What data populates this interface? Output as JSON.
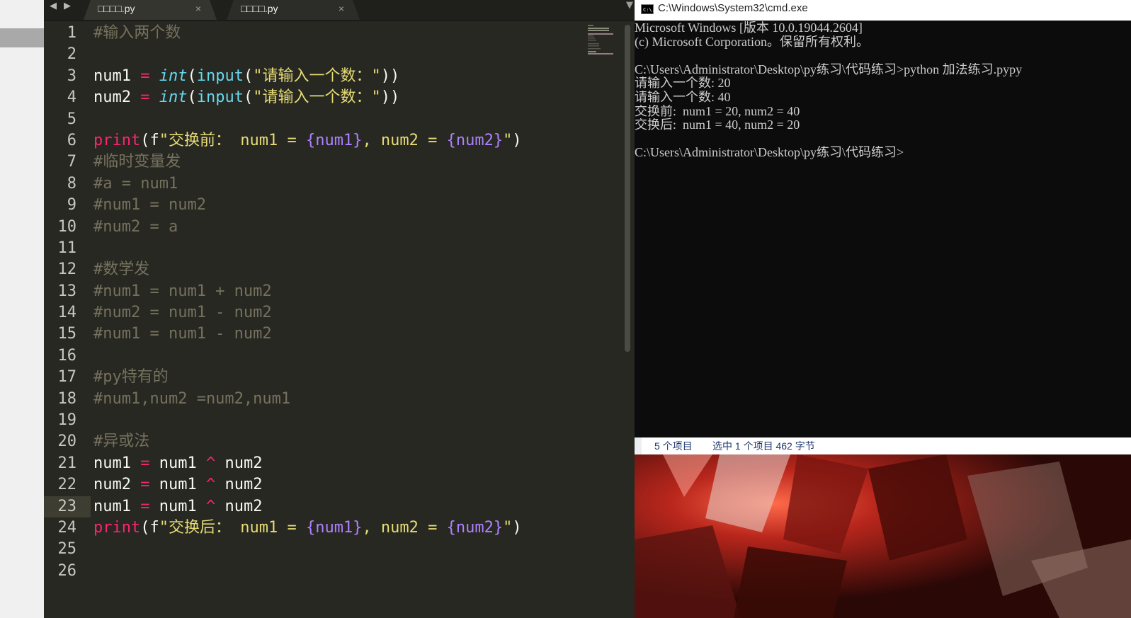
{
  "editor": {
    "tabs": [
      {
        "label": "□□□□.py",
        "close": "×"
      },
      {
        "label": "□□□□.py",
        "close": "×"
      }
    ],
    "nav_left": "◀",
    "nav_right": "▶",
    "dropdown": "▼",
    "lines": [
      {
        "n": "1",
        "segs": [
          {
            "t": "#输入两个数",
            "c": "c"
          }
        ]
      },
      {
        "n": "2",
        "segs": []
      },
      {
        "n": "3",
        "segs": [
          {
            "t": "num1",
            "c": "v"
          },
          {
            "t": " = ",
            "c": "k"
          },
          {
            "t": "int",
            "c": "t"
          },
          {
            "t": "(",
            "c": "v"
          },
          {
            "t": "input",
            "c": "f"
          },
          {
            "t": "(",
            "c": "v"
          },
          {
            "t": "\"请输入一个数：\"",
            "c": "s"
          },
          {
            "t": "))",
            "c": "v"
          }
        ]
      },
      {
        "n": "4",
        "segs": [
          {
            "t": "num2",
            "c": "v"
          },
          {
            "t": " = ",
            "c": "k"
          },
          {
            "t": "int",
            "c": "t"
          },
          {
            "t": "(",
            "c": "v"
          },
          {
            "t": "input",
            "c": "f"
          },
          {
            "t": "(",
            "c": "v"
          },
          {
            "t": "\"请输入一个数：\"",
            "c": "s"
          },
          {
            "t": "))",
            "c": "v"
          }
        ]
      },
      {
        "n": "5",
        "segs": []
      },
      {
        "n": "6",
        "segs": [
          {
            "t": "print",
            "c": "k"
          },
          {
            "t": "(f",
            "c": "v"
          },
          {
            "t": "\"交换前： num1 = ",
            "c": "s"
          },
          {
            "t": "{num1}",
            "c": "p"
          },
          {
            "t": ", num2 = ",
            "c": "s"
          },
          {
            "t": "{num2}",
            "c": "p"
          },
          {
            "t": "\"",
            "c": "s"
          },
          {
            "t": ")",
            "c": "v"
          }
        ]
      },
      {
        "n": "7",
        "segs": [
          {
            "t": "#临时变量发",
            "c": "c"
          }
        ]
      },
      {
        "n": "8",
        "segs": [
          {
            "t": "#a = num1",
            "c": "c"
          }
        ]
      },
      {
        "n": "9",
        "segs": [
          {
            "t": "#num1 = num2",
            "c": "c"
          }
        ]
      },
      {
        "n": "10",
        "segs": [
          {
            "t": "#num2 = a",
            "c": "c"
          }
        ]
      },
      {
        "n": "11",
        "segs": []
      },
      {
        "n": "12",
        "segs": [
          {
            "t": "#数学发",
            "c": "c"
          }
        ]
      },
      {
        "n": "13",
        "segs": [
          {
            "t": "#num1 = num1 + num2",
            "c": "c"
          }
        ]
      },
      {
        "n": "14",
        "segs": [
          {
            "t": "#num2 = num1 - num2",
            "c": "c"
          }
        ]
      },
      {
        "n": "15",
        "segs": [
          {
            "t": "#num1 = num1 - num2",
            "c": "c"
          }
        ]
      },
      {
        "n": "16",
        "segs": []
      },
      {
        "n": "17",
        "segs": [
          {
            "t": "#py特有的",
            "c": "c"
          }
        ]
      },
      {
        "n": "18",
        "segs": [
          {
            "t": "#num1,num2 =num2,num1",
            "c": "c"
          }
        ]
      },
      {
        "n": "19",
        "segs": []
      },
      {
        "n": "20",
        "segs": [
          {
            "t": "#异或法",
            "c": "c"
          }
        ]
      },
      {
        "n": "21",
        "segs": [
          {
            "t": "num1",
            "c": "v"
          },
          {
            "t": " = ",
            "c": "k"
          },
          {
            "t": "num1",
            "c": "v"
          },
          {
            "t": " ^ ",
            "c": "k"
          },
          {
            "t": "num2",
            "c": "v"
          }
        ]
      },
      {
        "n": "22",
        "segs": [
          {
            "t": "num2",
            "c": "v"
          },
          {
            "t": " = ",
            "c": "k"
          },
          {
            "t": "num1",
            "c": "v"
          },
          {
            "t": " ^ ",
            "c": "k"
          },
          {
            "t": "num2",
            "c": "v"
          }
        ]
      },
      {
        "n": "23",
        "current": true,
        "segs": [
          {
            "t": "num1",
            "c": "v"
          },
          {
            "t": " = ",
            "c": "k"
          },
          {
            "t": "num1",
            "c": "v"
          },
          {
            "t": " ^ ",
            "c": "k"
          },
          {
            "t": "num2",
            "c": "v"
          }
        ]
      },
      {
        "n": "24",
        "segs": [
          {
            "t": "print",
            "c": "k"
          },
          {
            "t": "(f",
            "c": "v"
          },
          {
            "t": "\"交换后： num1 = ",
            "c": "s"
          },
          {
            "t": "{num1}",
            "c": "p"
          },
          {
            "t": ", num2 = ",
            "c": "s"
          },
          {
            "t": "{num2}",
            "c": "p"
          },
          {
            "t": "\"",
            "c": "s"
          },
          {
            "t": ")",
            "c": "v"
          }
        ]
      },
      {
        "n": "25",
        "segs": []
      },
      {
        "n": "26",
        "segs": []
      }
    ]
  },
  "cmd": {
    "title": "C:\\Windows\\System32\\cmd.exe",
    "icon_text": "C:\\.",
    "lines": [
      "Microsoft Windows [版本 10.0.19044.2604]",
      "(c) Microsoft Corporation。保留所有权利。",
      "",
      "C:\\Users\\Administrator\\Desktop\\py练习\\代码练习>python 加法练习.pypy",
      "请输入一个数: 20",
      "请输入一个数: 40",
      "交换前:  num1 = 20, num2 = 40",
      "交换后:  num1 = 40, num2 = 20",
      "",
      "C:\\Users\\Administrator\\Desktop\\py练习\\代码练习>"
    ]
  },
  "explorer_status": {
    "items": "5 个项目",
    "selected": "选中 1 个项目  462 字节"
  },
  "colors": {
    "editor_bg": "#272822",
    "comment": "#75715e",
    "keyword": "#f92672",
    "builtin": "#66d9ef",
    "string": "#e6db74",
    "constant": "#ae81ff",
    "cmd_bg": "#0c0c0c"
  }
}
